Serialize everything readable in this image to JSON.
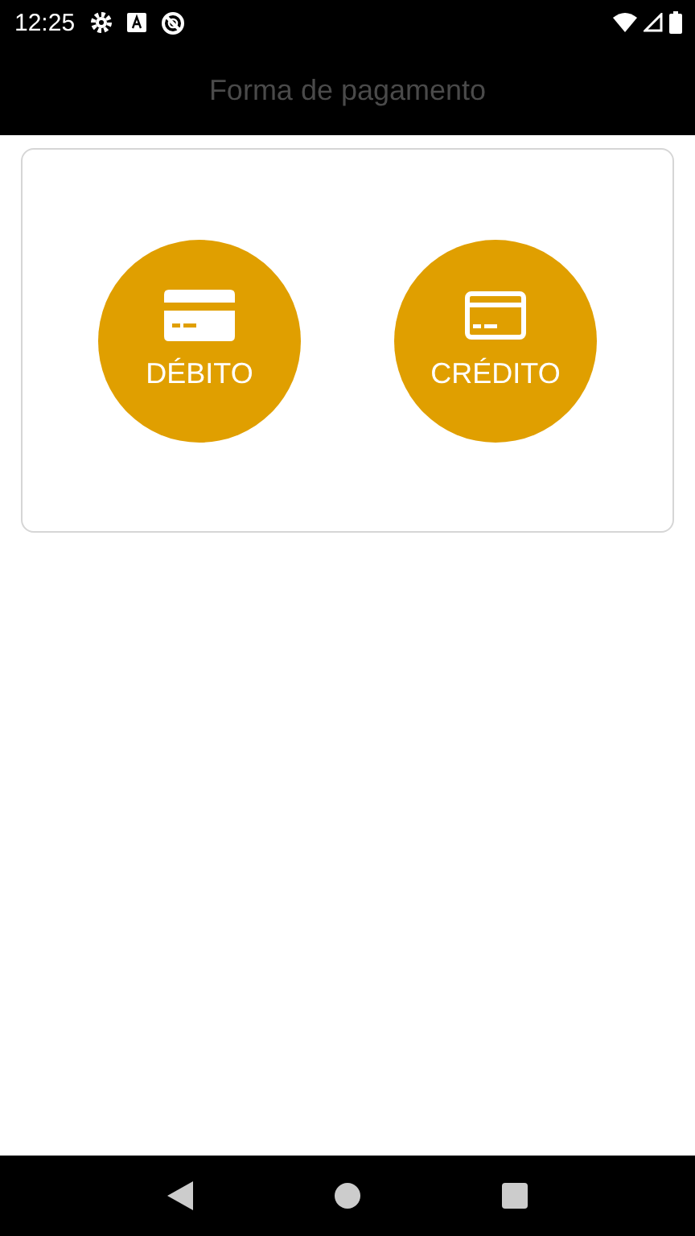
{
  "status_bar": {
    "time": "12:25"
  },
  "app_bar": {
    "title": "Forma de pagamento"
  },
  "options": [
    {
      "label": "DÉBITO",
      "kind": "filled"
    },
    {
      "label": "CRÉDITO",
      "kind": "outlined"
    }
  ]
}
